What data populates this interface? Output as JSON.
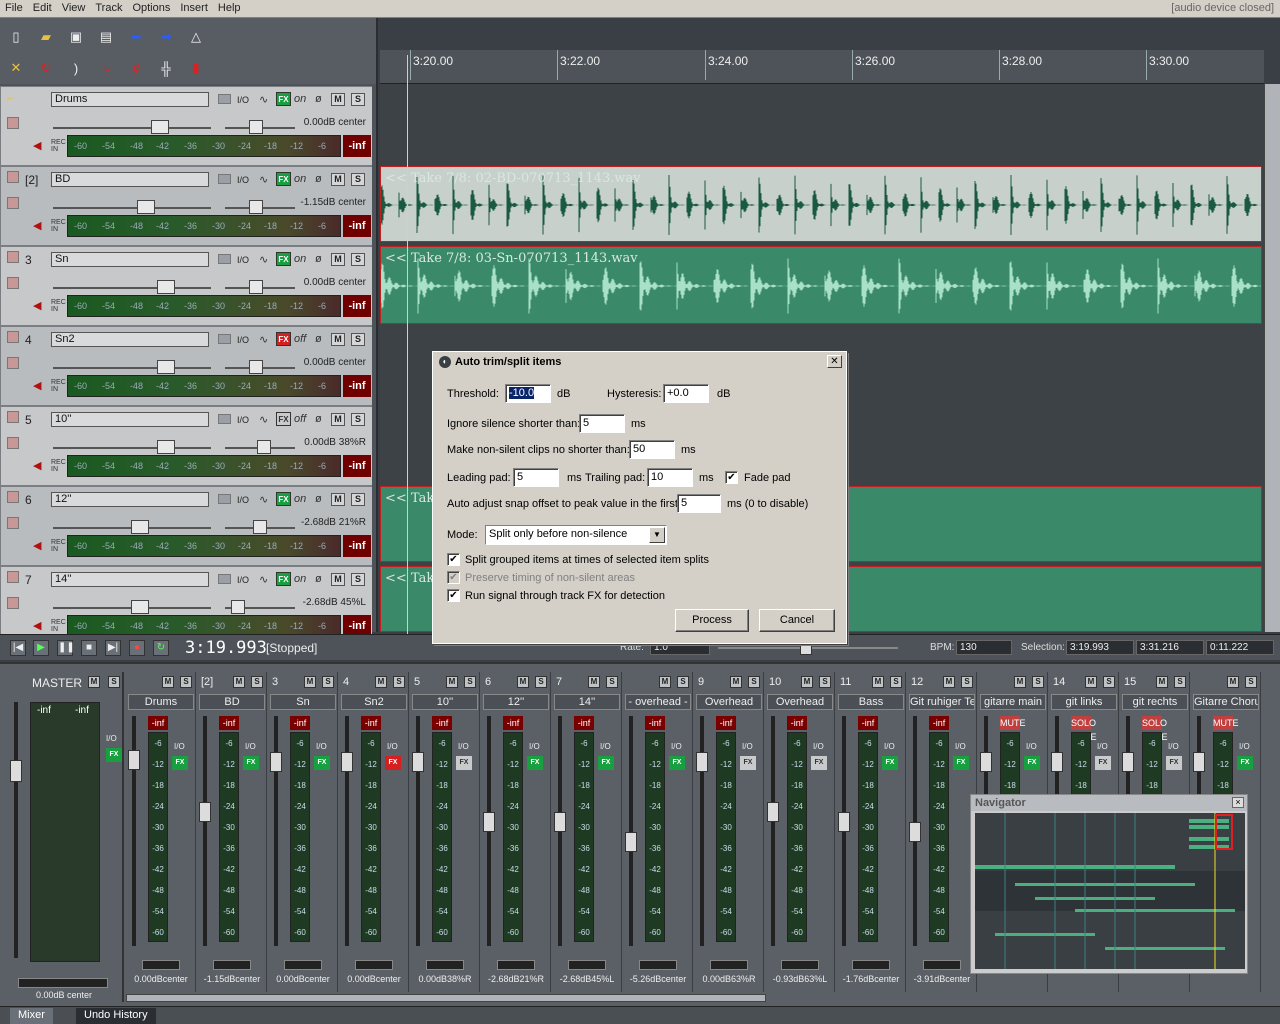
{
  "menu": [
    "File",
    "Edit",
    "View",
    "Track",
    "Options",
    "Insert",
    "Help"
  ],
  "device_status": "[audio device closed]",
  "ruler": {
    "labels": [
      "3:20.00",
      "3:22.00",
      "3:24.00",
      "3:26.00",
      "3:28.00",
      "3:30.00"
    ]
  },
  "tracks": [
    {
      "num": "",
      "name": "Drums",
      "fx": "on",
      "onoff": "on",
      "vol": "0.00dB center",
      "inf": "-inf"
    },
    {
      "num": "[2]",
      "name": "BD",
      "fx": "on",
      "onoff": "on",
      "vol": "-1.15dB center",
      "inf": "-inf"
    },
    {
      "num": "3",
      "name": "Sn",
      "fx": "on",
      "onoff": "on",
      "vol": "0.00dB center",
      "inf": "-inf"
    },
    {
      "num": "4",
      "name": "Sn2",
      "fx": "off",
      "onoff": "off",
      "vol": "0.00dB center",
      "inf": "-inf"
    },
    {
      "num": "5",
      "name": "10''",
      "fx": "bypass",
      "onoff": "off",
      "vol": "0.00dB 38%R",
      "inf": "-inf"
    },
    {
      "num": "6",
      "name": "12''",
      "fx": "on",
      "onoff": "on",
      "vol": "-2.68dB 21%R",
      "inf": "-inf"
    },
    {
      "num": "7",
      "name": "14''",
      "fx": "on",
      "onoff": "on",
      "vol": "-2.68dB 45%L",
      "inf": "-inf"
    }
  ],
  "meter_scale": [
    "-60",
    "-54",
    "-48",
    "-42",
    "-36",
    "-30",
    "-24",
    "-18",
    "-12",
    "-6"
  ],
  "labels": {
    "io": "I/O",
    "m": "M",
    "s": "S",
    "fx": "FX",
    "rec_in": "REC IN"
  },
  "items": [
    {
      "label": "<< Take 7/8: 02-BD-070713_1143.wav"
    },
    {
      "label": "<< Take 7/8: 03-Sn-070713_1143.wav"
    },
    {
      "label": "<< Take"
    },
    {
      "label": "<< Take"
    }
  ],
  "transport": {
    "time": "3:19.993",
    "status": "[Stopped]",
    "rate_label": "Rate:",
    "rate": "1.0",
    "bpm_label": "BPM:",
    "bpm": "130",
    "sel_label": "Selection:",
    "sel_start": "3:19.993",
    "sel_end": "3:31.216",
    "sel_len": "0:11.222"
  },
  "dialog": {
    "title": "Auto trim/split items",
    "threshold_label": "Threshold:",
    "threshold": "-10.0",
    "db": "dB",
    "hysteresis_label": "Hysteresis:",
    "hysteresis": "+0.0",
    "ignore_label": "Ignore silence shorter than:",
    "ignore": "5",
    "ms": "ms",
    "nonsilent_label": "Make non-silent clips no shorter than:",
    "nonsilent": "50",
    "leading_label": "Leading pad:",
    "leading": "5",
    "trailing_label": "Trailing pad:",
    "trailing": "10",
    "fade_label": "Fade pad",
    "snap_label": "Auto adjust snap offset to peak value in the first",
    "snap": "5",
    "snap_suffix": "ms (0 to disable)",
    "mode_label": "Mode:",
    "mode": "Split only before non-silence",
    "split_grouped": "Split grouped items at times of selected item splits",
    "preserve": "Preserve timing of non-silent areas",
    "run_fx": "Run signal through track FX for detection",
    "process": "Process",
    "cancel": "Cancel"
  },
  "mixer": {
    "master": {
      "name": "MASTER",
      "inf_l": "-inf",
      "inf_r": "-inf",
      "vol": "0.00dB center"
    },
    "strips": [
      {
        "num": "",
        "name": "Drums",
        "vol": "0.00dBcenter",
        "fx": "on",
        "inf": "-inf"
      },
      {
        "num": "[2]",
        "name": "BD",
        "vol": "-1.15dBcenter",
        "fx": "on",
        "inf": "-inf"
      },
      {
        "num": "3",
        "name": "Sn",
        "vol": "0.00dBcenter",
        "fx": "on",
        "inf": "-inf"
      },
      {
        "num": "4",
        "name": "Sn2",
        "vol": "0.00dBcenter",
        "fx": "off",
        "inf": "-inf"
      },
      {
        "num": "5",
        "name": "10''",
        "vol": "0.00dB38%R",
        "fx": "bypass",
        "inf": "-inf"
      },
      {
        "num": "6",
        "name": "12''",
        "vol": "-2.68dB21%R",
        "fx": "on",
        "inf": "-inf"
      },
      {
        "num": "7",
        "name": "14''",
        "vol": "-2.68dB45%L",
        "fx": "on",
        "inf": "-inf"
      },
      {
        "num": "",
        "name": "- overhead -",
        "vol": "-5.26dBcenter",
        "fx": "on",
        "inf": "-inf"
      },
      {
        "num": "9",
        "name": "Overhead",
        "vol": "0.00dB63%R",
        "fx": "bypass",
        "inf": "-inf"
      },
      {
        "num": "10",
        "name": "Overhead",
        "vol": "-0.93dB63%L",
        "fx": "bypass",
        "inf": "-inf"
      },
      {
        "num": "11",
        "name": "Bass",
        "vol": "-1.76dBcenter",
        "fx": "on",
        "inf": "-inf"
      },
      {
        "num": "12",
        "name": "Git ruhiger Te",
        "vol": "-3.91dBcenter",
        "fx": "on",
        "inf": "-inf"
      },
      {
        "num": "",
        "name": "gitarre main",
        "vol": "",
        "fx": "on",
        "inf": "MUTE"
      },
      {
        "num": "14",
        "name": "git links",
        "vol": "",
        "fx": "bypass",
        "inf": "SOLO MUTE"
      },
      {
        "num": "15",
        "name": "git rechts",
        "vol": "",
        "fx": "bypass",
        "inf": "SOLO MUTE"
      },
      {
        "num": "",
        "name": "Gitarre Chorus",
        "vol": "",
        "fx": "on",
        "inf": "MUTE"
      }
    ]
  },
  "navigator": {
    "title": "Navigator"
  },
  "tabs": [
    "Mixer",
    "Undo History"
  ]
}
